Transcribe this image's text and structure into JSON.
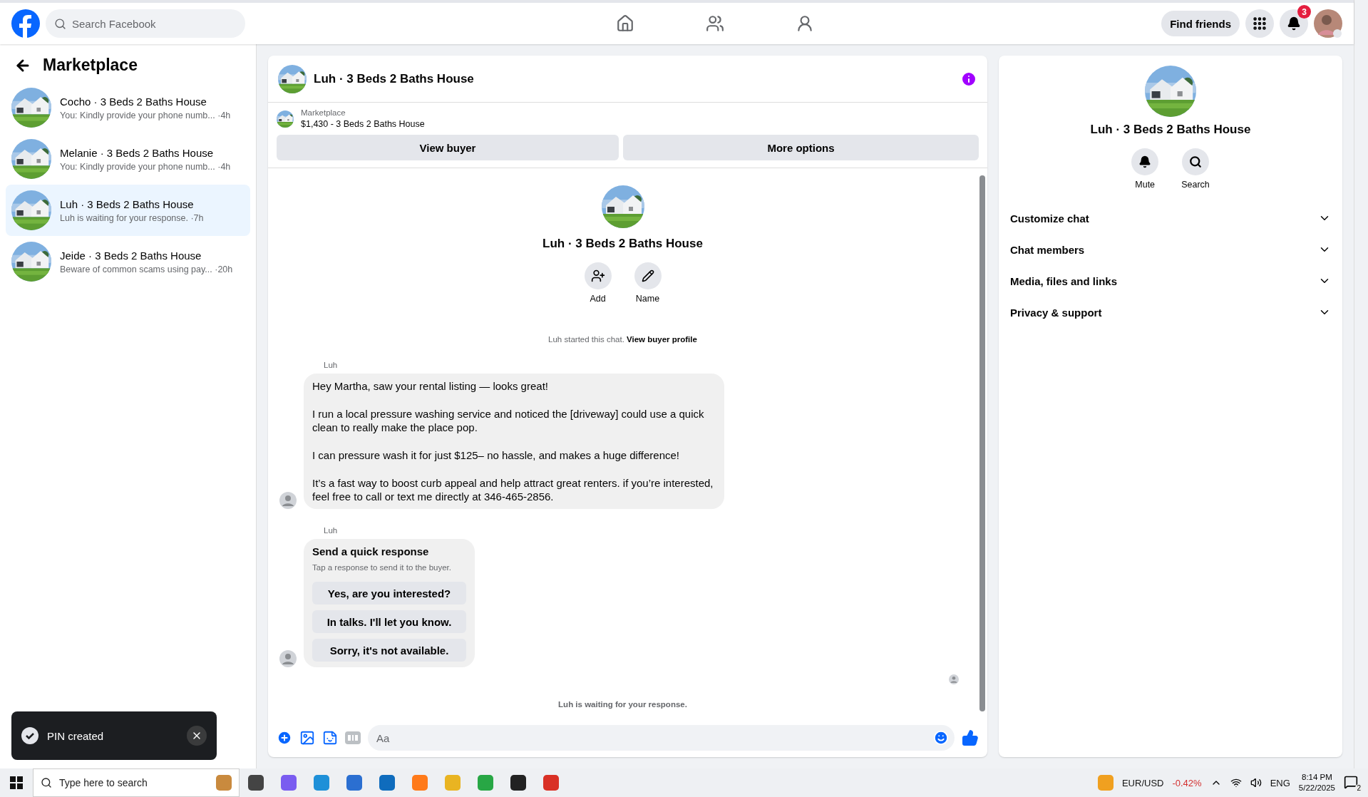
{
  "top_bar": {
    "search": {
      "placeholder": "Search Facebook"
    },
    "nav": [
      {
        "kind": "home"
      },
      {
        "kind": "friends"
      },
      {
        "kind": "groups"
      }
    ],
    "find_friends": "Find friends",
    "notifications_badge": "3"
  },
  "sidebar": {
    "title": "Marketplace",
    "conversations": [
      {
        "title": "Cocho · 3 Beds 2 Baths House",
        "preview": "You: Kindly provide your phone numb...",
        "time": "·4h",
        "selected": false
      },
      {
        "title": "Melanie · 3 Beds 2 Baths House",
        "preview": "You: Kindly provide your phone numb...",
        "time": "·4h",
        "selected": false
      },
      {
        "title": "Luh · 3 Beds 2 Baths House",
        "preview": "Luh is waiting for your response.",
        "time": "·7h",
        "selected": true
      },
      {
        "title": "Jeide · 3 Beds 2 Baths House",
        "preview": "Beware of common scams using pay...",
        "time": "·20h",
        "selected": false
      }
    ]
  },
  "chat": {
    "title": "Luh · 3 Beds 2 Baths House",
    "listing": {
      "label": "Marketplace",
      "text": "$1,430 - 3 Beds 2 Baths House"
    },
    "buttons": [
      "View buyer",
      "More options"
    ],
    "profile": {
      "name": "Luh · 3 Beds 2 Baths House",
      "actions": [
        {
          "kind": "add",
          "label": "Add"
        },
        {
          "kind": "name",
          "label": "Name"
        }
      ]
    },
    "started": {
      "text": "Luh started this chat.",
      "link": "View buyer profile"
    },
    "messages": [
      {
        "kind": "text",
        "sender": "Luh",
        "paragraphs": [
          "Hey Martha, saw your rental listing — looks great!",
          "I run a local pressure washing service and noticed the [driveway] could use a quick clean to really make the place pop.",
          "I can pressure wash it for just $125– no hassle, and makes a huge difference!",
          "It’s a fast way to boost curb appeal and help attract great renters. if you’re interested, feel free to call or text me directly at 346-465-2856."
        ]
      },
      {
        "kind": "quick",
        "sender": "Luh",
        "title": "Send a quick response",
        "subtitle": "Tap a response to send it to the buyer.",
        "options": [
          "Yes, are you interested?",
          "In talks. I'll let you know.",
          "Sorry, it's not available."
        ]
      }
    ],
    "status": "Luh is waiting for your response.",
    "composer": {
      "placeholder": "Aa"
    }
  },
  "details": {
    "name": "Luh · 3 Beds 2 Baths House",
    "actions": [
      {
        "kind": "mute",
        "label": "Mute"
      },
      {
        "kind": "search",
        "label": "Search"
      }
    ],
    "sections": [
      {
        "label": "Customize chat",
        "expanded": false
      },
      {
        "label": "Chat members",
        "expanded": false
      },
      {
        "label": "Media, files and links",
        "expanded": false
      },
      {
        "label": "Privacy & support",
        "expanded": false
      }
    ]
  },
  "toast": {
    "text": "PIN created"
  },
  "taskbar": {
    "search": {
      "placeholder": "Type here to search"
    },
    "ticker": {
      "pair": "EUR/USD",
      "change": "-0.42%"
    },
    "language": "ENG",
    "time": "8:14 PM",
    "date": "5/22/2025",
    "notification_count": "2"
  }
}
